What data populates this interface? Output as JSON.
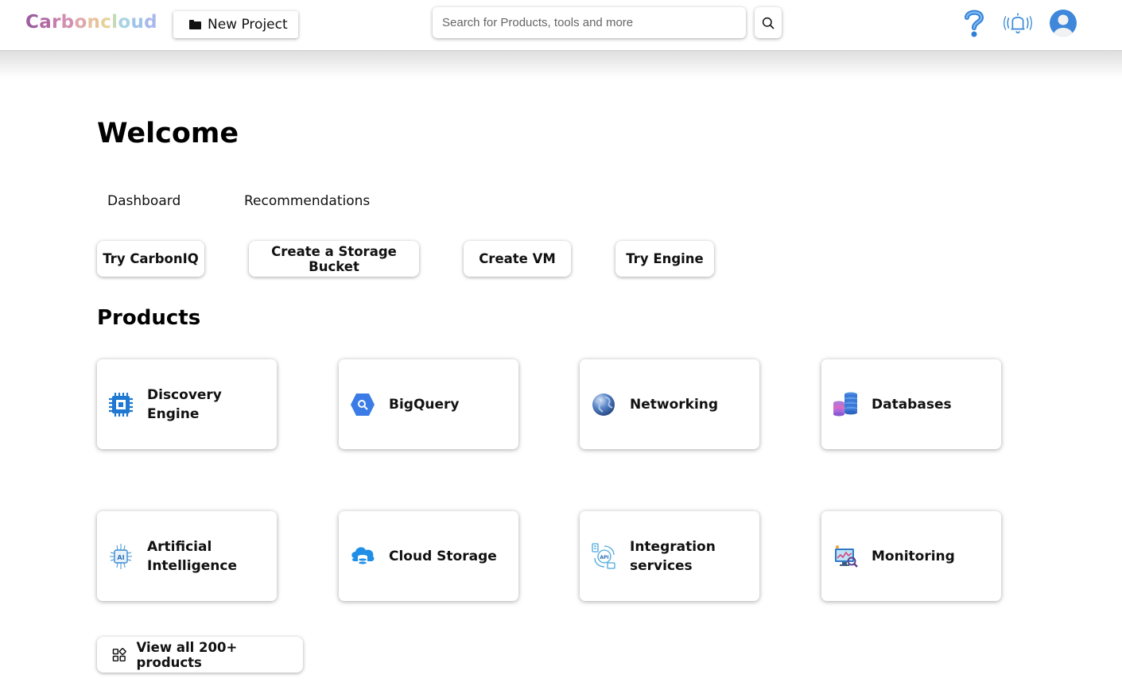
{
  "header": {
    "logo_text": "Carbon cloud",
    "new_project_label": "New Project",
    "search_placeholder": "Search for Products, tools and more",
    "icons": [
      "question-icon",
      "bell-icon",
      "user-avatar-icon",
      "search-icon",
      "folder-icon"
    ]
  },
  "main": {
    "title": "Welcome",
    "tabs": [
      {
        "label": "Dashboard"
      },
      {
        "label": "Recommendations"
      }
    ],
    "quick_actions": [
      {
        "label": "Try CarbonIQ"
      },
      {
        "label": "Create a Storage Bucket"
      },
      {
        "label": "Create VM"
      },
      {
        "label": "Try Engine"
      }
    ],
    "products_title": "Products",
    "products": [
      {
        "label": "Discovery Engine",
        "icon": "chip-icon"
      },
      {
        "label": "BigQuery",
        "icon": "bigquery-icon"
      },
      {
        "label": "Networking",
        "icon": "globe-icon"
      },
      {
        "label": "Databases",
        "icon": "database-icon"
      },
      {
        "label": "Artificial Intelligence",
        "icon": "ai-chip-icon"
      },
      {
        "label": "Cloud Storage",
        "icon": "cloud-storage-icon"
      },
      {
        "label": "Integration services",
        "icon": "api-icon"
      },
      {
        "label": "Monitoring",
        "icon": "monitoring-icon"
      }
    ],
    "view_all_label": "View all 200+ products"
  },
  "colors": {
    "accent_blue": "#2f7fd6",
    "logo_gradient": [
      "#9c5fa8",
      "#d88fb5",
      "#e9c98a",
      "#a9d3e8",
      "#9bb7e8"
    ]
  }
}
